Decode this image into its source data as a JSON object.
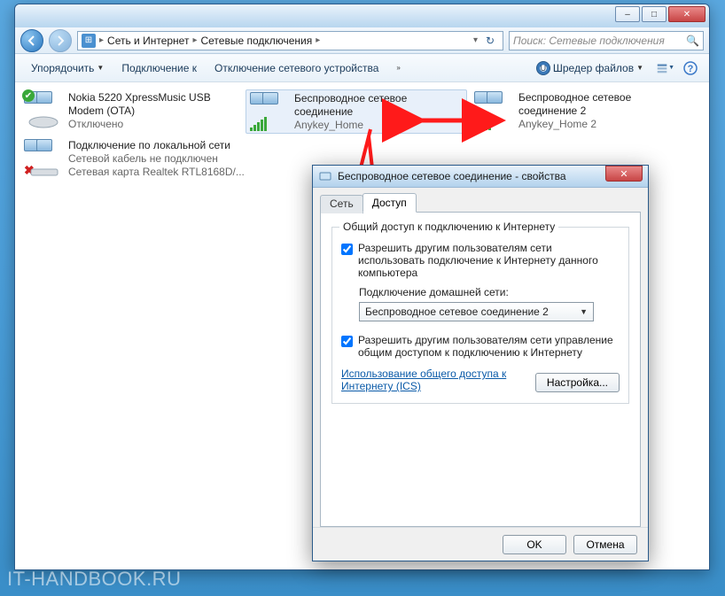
{
  "explorer": {
    "breadcrumb": [
      "Сеть и Интернет",
      "Сетевые подключения"
    ],
    "search_placeholder": "Поиск: Сетевые подключения",
    "toolbar": {
      "organize": "Упорядочить",
      "connect_to": "Подключение к",
      "disable_adapter": "Отключение сетевого устройства",
      "shredder": "Шредер файлов"
    },
    "items": [
      {
        "title": "Nokia 5220 XpressMusic USB Modem (OTA)",
        "line2": "Отключено",
        "line3": "",
        "icon": "modem-disabled"
      },
      {
        "title": "Беспроводное сетевое соединение",
        "line2": "Anykey_Home",
        "line3": "",
        "icon": "wifi",
        "selected": true
      },
      {
        "title": "Беспроводное сетевое соединение 2",
        "line2": "Anykey_Home 2",
        "line3": "",
        "icon": "wifi"
      },
      {
        "title": "Подключение по локальной сети",
        "line2": "Сетевой кабель не подключен",
        "line3": "Сетевая карта Realtek RTL8168D/...",
        "icon": "lan-unplugged"
      }
    ]
  },
  "dialog": {
    "title": "Беспроводное сетевое соединение - свойства",
    "tabs": {
      "network": "Сеть",
      "sharing": "Доступ"
    },
    "group_title": "Общий доступ к подключению к Интернету",
    "chk1": "Разрешить другим пользователям сети использовать подключение к Интернету данного компьютера",
    "home_label": "Подключение домашней сети:",
    "home_value": "Беспроводное сетевое соединение 2",
    "chk2": "Разрешить другим пользователям сети управление общим доступом к подключению к Интернету",
    "ics_link": "Использование общего доступа к Интернету (ICS)",
    "settings_btn": "Настройка...",
    "ok": "OK",
    "cancel": "Отмена"
  },
  "watermark": "IT-HANDBOOK.RU"
}
